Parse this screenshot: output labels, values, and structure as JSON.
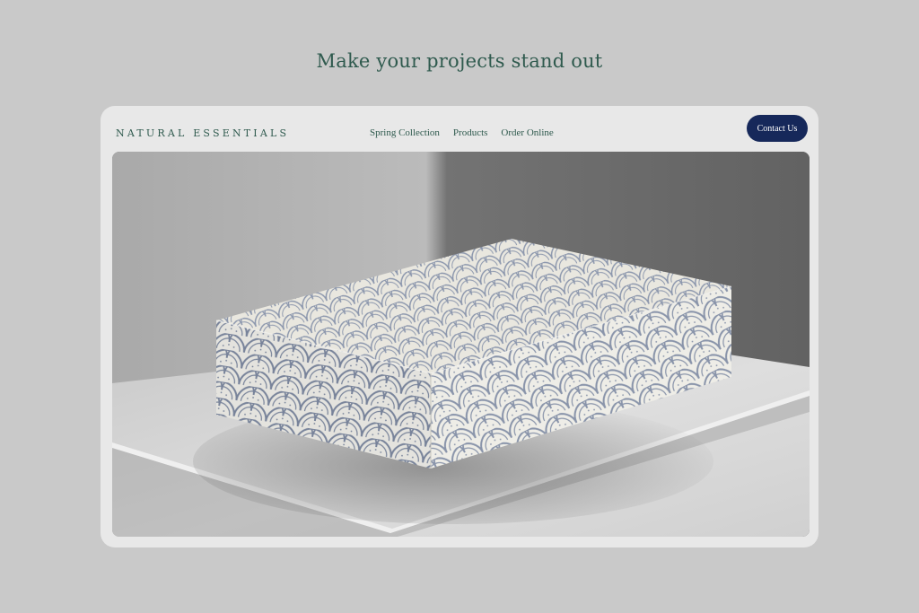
{
  "headline": "Make your projects stand out",
  "header": {
    "brand": "NATURAL ESSENTIALS",
    "nav": [
      "Spring Collection",
      "Products",
      "Order Online"
    ],
    "cta": "Contact Us"
  },
  "colors": {
    "page_background": "#c9c9c9",
    "card_background": "#e8e8e8",
    "text_green": "#2f5a4e",
    "button_navy": "#16285a",
    "pattern_blue": "#7f8ba3",
    "pattern_cream": "#ecebe4"
  },
  "hero": {
    "image": "patterned-box-mockup"
  }
}
